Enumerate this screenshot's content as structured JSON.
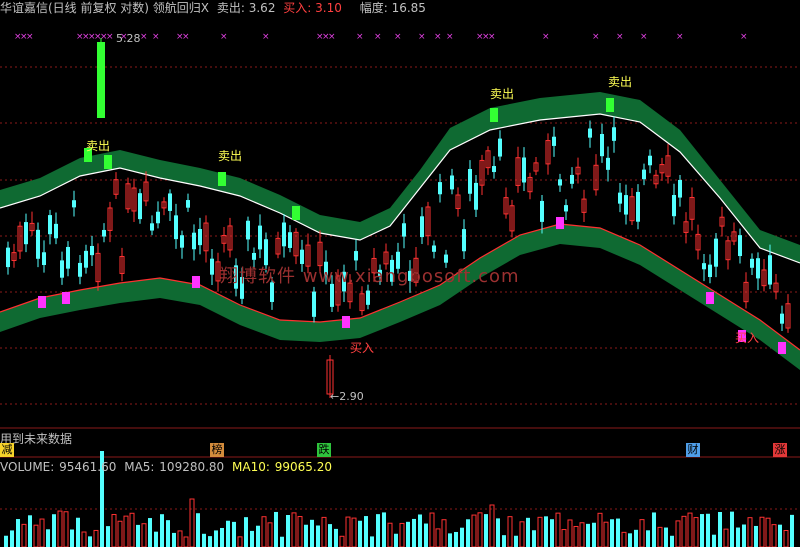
{
  "header": {
    "title": "华谊嘉信(日线 前复权 对数) 领航回归X",
    "sell_label": "卖出:",
    "sell_value": "3.62",
    "buy_label": "买入:",
    "buy_value": "3.10",
    "range_label": "幅度:",
    "range_value": "16.85"
  },
  "annotations": {
    "high_price": "5.28",
    "low_price": "2.90",
    "sell_marker": "卖出",
    "buy_marker": "买入",
    "cross_marker": "×"
  },
  "watermark": "翔博软件 www.xiangbosoft.com",
  "future_data_note": "用到未来数据",
  "tags": [
    {
      "label": "减",
      "color": "#f7d32a"
    },
    {
      "label": "榜",
      "color": "#d48c3c"
    },
    {
      "label": "跌",
      "color": "#2ec43c"
    },
    {
      "label": "财",
      "color": "#4f9ee8"
    },
    {
      "label": "涨",
      "color": "#e23838"
    }
  ],
  "volume_header": {
    "volume_label": "VOLUME:",
    "volume_value": "95461.60",
    "ma5_label": "MA5:",
    "ma5_value": "109280.80",
    "ma10_label": "MA10:",
    "ma10_value": "99065.20"
  },
  "colors": {
    "up_candle": "#ff3232",
    "down_candle": "#54ffff",
    "band_fill": "#0f6a32",
    "band_edge_upper": "#ffffff",
    "band_edge_lower": "#ff3030",
    "sell_box": "#33ff33",
    "buy_box": "#ff33ff",
    "grid": "#8a1a1a",
    "header_white": "#c0c0c0",
    "header_yellow": "#ffff54",
    "header_red": "#ff4040"
  }
}
